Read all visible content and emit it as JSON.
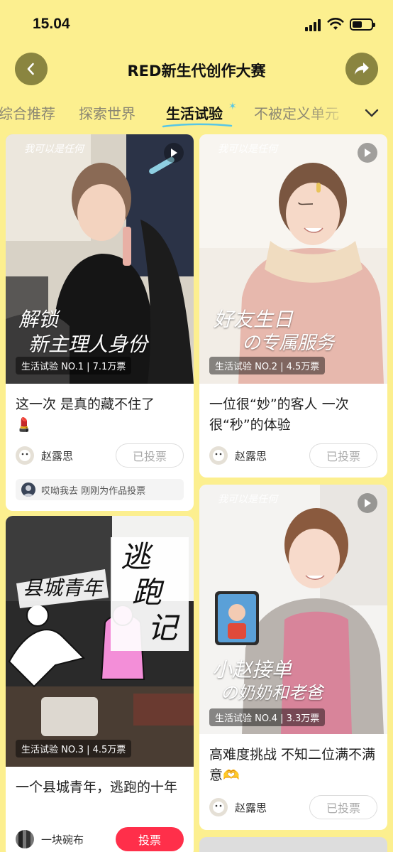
{
  "status_bar": {
    "time": "15.04"
  },
  "header": {
    "title": "RED新生代创作大赛"
  },
  "tabs": [
    {
      "label": "综合推荐"
    },
    {
      "label": "探索世界"
    },
    {
      "label": "生活试验",
      "active": true
    },
    {
      "label": "不被定义单元"
    }
  ],
  "logo_text": "我可以是任何",
  "cards": [
    {
      "image_badge": "生活试验 NO.1 | 7.1万票",
      "image_title": [
        "解锁",
        "新主理人身份"
      ],
      "title": "这一次 是真的藏不住了",
      "emoji": "💄",
      "author": "赵露思",
      "vote_label": "已投票",
      "activity": "哎呦我去  刚刚为作品投票"
    },
    {
      "image_badge": "生活试验 NO.2 | 4.5万票",
      "image_title": [
        "好友生日",
        "の专属服务"
      ],
      "title": "一位很“妙”的客人 一次很“秒”的体验",
      "author": "赵露思",
      "vote_label": "已投票"
    },
    {
      "image_badge": "生活试验 NO.3 | 4.5万票",
      "image_title": [
        "县城青年",
        "逃",
        "跑",
        "记"
      ],
      "title": "一个县城青年，逃跑的十年",
      "author": "一块碗布",
      "vote_label": "投票"
    },
    {
      "image_badge": "生活试验 NO.4 | 3.3万票",
      "image_title": [
        "小赵接单",
        "の奶奶和老爸"
      ],
      "title": "高难度挑战 不知二位满不满意",
      "emoji": "🫶",
      "author": "赵露思",
      "vote_label": "已投票"
    }
  ],
  "colors": {
    "background": "#fcef8f",
    "vote_red": "#ff2f4a",
    "tab_accent": "#57c6e6"
  }
}
